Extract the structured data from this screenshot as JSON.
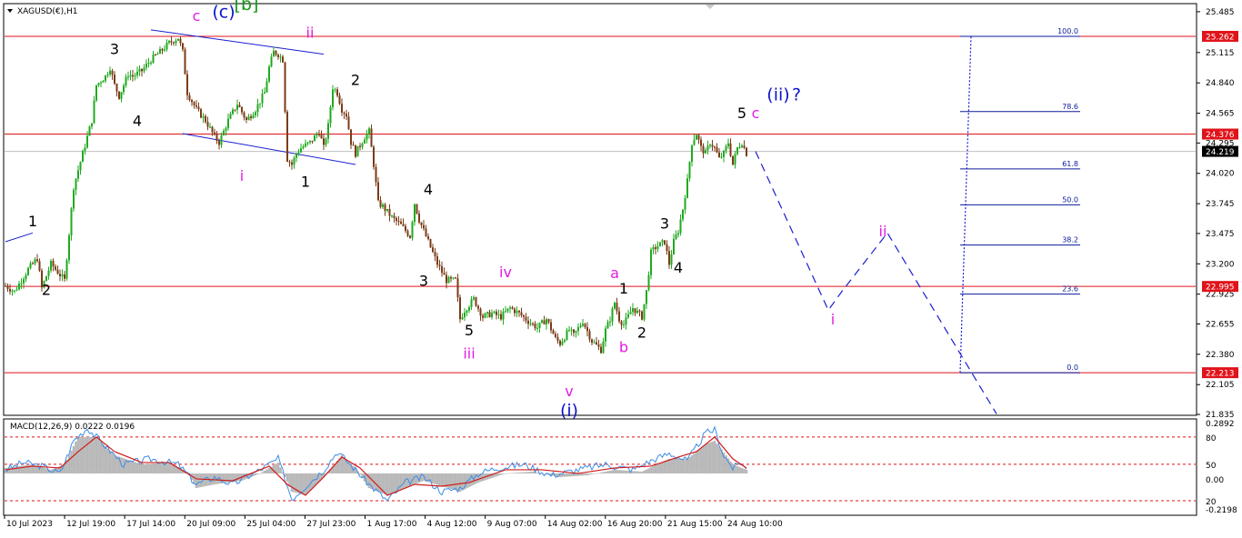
{
  "chart_data": {
    "type": "candlestick",
    "symbol_label": "XAGUSD(€),H1",
    "macd_label": "MACD(12,26,9) 0.0222 0.0196",
    "colors": {
      "up": "#1faa1f",
      "down": "#7a3b16",
      "hline": "#e0131a",
      "price_tag": "#e0131a",
      "current_tag": "#000000",
      "fib": "#0a1a9c",
      "projection": "#1b1fd0",
      "wave_magenta": "#e21ce0",
      "wave_black": "#000000",
      "wave_blue": "#0d15c8",
      "wave_green": "#0f9b0f",
      "macd_hist": "#b8b8b8",
      "macd_main": "#3d8ee6",
      "macd_signal": "#d11a1a",
      "macd_level": "#e0131a"
    },
    "price_axis": {
      "range": [
        21.835,
        25.55
      ],
      "ticks": [
        "25.485",
        "25.115",
        "24.840",
        "24.565",
        "24.295",
        "24.020",
        "23.745",
        "23.475",
        "23.200",
        "22.925",
        "22.655",
        "22.380",
        "22.105",
        "21.835"
      ]
    },
    "price_tags": [
      {
        "label": "25.262",
        "price": 25.262,
        "kind": "level"
      },
      {
        "label": "24.376",
        "price": 24.376,
        "kind": "level"
      },
      {
        "label": "24.219",
        "price": 24.219,
        "kind": "current"
      },
      {
        "label": "22.995",
        "price": 22.995,
        "kind": "level"
      },
      {
        "label": "22.213",
        "price": 22.213,
        "kind": "level"
      }
    ],
    "horizontal_levels": [
      25.262,
      24.376,
      22.995,
      22.213
    ],
    "current_price": 24.219,
    "time_axis": [
      "10 Jul 2023",
      "12 Jul 19:00",
      "17 Jul 14:00",
      "20 Jul 09:00",
      "25 Jul 04:00",
      "27 Jul 23:00",
      "1 Aug 17:00",
      "4 Aug 12:00",
      "9 Aug 07:00",
      "14 Aug 02:00",
      "16 Aug 20:00",
      "21 Aug 15:00",
      "24 Aug 10:00"
    ],
    "fib_levels": [
      {
        "label": "100.0",
        "price": 25.262
      },
      {
        "label": "78.6",
        "price": 24.58
      },
      {
        "label": "61.8",
        "price": 24.06
      },
      {
        "label": "50.0",
        "price": 23.735
      },
      {
        "label": "38.2",
        "price": 23.37
      },
      {
        "label": "23.6",
        "price": 22.925
      },
      {
        "label": "0.0",
        "price": 22.213
      }
    ],
    "price_path": [
      {
        "t": 0,
        "p": 23.0
      },
      {
        "t": 2,
        "p": 22.95
      },
      {
        "t": 5,
        "p": 23.15
      },
      {
        "t": 7,
        "p": 23.25
      },
      {
        "t": 8,
        "p": 22.98
      },
      {
        "t": 10,
        "p": 23.2
      },
      {
        "t": 12,
        "p": 23.1
      },
      {
        "t": 13,
        "p": 23.05
      },
      {
        "t": 15,
        "p": 23.9
      },
      {
        "t": 17,
        "p": 24.2
      },
      {
        "t": 19,
        "p": 24.5
      },
      {
        "t": 20,
        "p": 24.82
      },
      {
        "t": 22,
        "p": 24.9
      },
      {
        "t": 23,
        "p": 24.98
      },
      {
        "t": 24,
        "p": 24.82
      },
      {
        "t": 25,
        "p": 24.72
      },
      {
        "t": 27,
        "p": 24.92
      },
      {
        "t": 28,
        "p": 24.9
      },
      {
        "t": 30,
        "p": 24.95
      },
      {
        "t": 32,
        "p": 25.05
      },
      {
        "t": 34,
        "p": 25.12
      },
      {
        "t": 36,
        "p": 25.2
      },
      {
        "t": 38,
        "p": 25.25
      },
      {
        "t": 39,
        "p": 25.12
      },
      {
        "t": 40,
        "p": 24.75
      },
      {
        "t": 42,
        "p": 24.6
      },
      {
        "t": 44,
        "p": 24.5
      },
      {
        "t": 46,
        "p": 24.35
      },
      {
        "t": 47,
        "p": 24.3
      },
      {
        "t": 49,
        "p": 24.5
      },
      {
        "t": 51,
        "p": 24.65
      },
      {
        "t": 53,
        "p": 24.5
      },
      {
        "t": 55,
        "p": 24.6
      },
      {
        "t": 57,
        "p": 24.75
      },
      {
        "t": 58,
        "p": 24.98
      },
      {
        "t": 59,
        "p": 25.12
      },
      {
        "t": 60,
        "p": 25.1
      },
      {
        "t": 61,
        "p": 25.05
      },
      {
        "t": 62,
        "p": 24.15
      },
      {
        "t": 63,
        "p": 24.1
      },
      {
        "t": 64,
        "p": 24.2
      },
      {
        "t": 65,
        "p": 24.25
      },
      {
        "t": 67,
        "p": 24.3
      },
      {
        "t": 69,
        "p": 24.4
      },
      {
        "t": 70,
        "p": 24.25
      },
      {
        "t": 71,
        "p": 24.45
      },
      {
        "t": 72,
        "p": 24.8
      },
      {
        "t": 73,
        "p": 24.75
      },
      {
        "t": 74,
        "p": 24.6
      },
      {
        "t": 75,
        "p": 24.55
      },
      {
        "t": 76,
        "p": 24.3
      },
      {
        "t": 77,
        "p": 24.2
      },
      {
        "t": 79,
        "p": 24.35
      },
      {
        "t": 80,
        "p": 24.4
      },
      {
        "t": 81,
        "p": 24.1
      },
      {
        "t": 82,
        "p": 23.75
      },
      {
        "t": 83,
        "p": 23.72
      },
      {
        "t": 85,
        "p": 23.62
      },
      {
        "t": 87,
        "p": 23.55
      },
      {
        "t": 89,
        "p": 23.45
      },
      {
        "t": 90,
        "p": 23.75
      },
      {
        "t": 91,
        "p": 23.6
      },
      {
        "t": 93,
        "p": 23.4
      },
      {
        "t": 95,
        "p": 23.2
      },
      {
        "t": 97,
        "p": 23.05
      },
      {
        "t": 99,
        "p": 23.05
      },
      {
        "t": 100,
        "p": 22.7
      },
      {
        "t": 101,
        "p": 22.78
      },
      {
        "t": 103,
        "p": 22.88
      },
      {
        "t": 105,
        "p": 22.72
      },
      {
        "t": 107,
        "p": 22.75
      },
      {
        "t": 109,
        "p": 22.72
      },
      {
        "t": 111,
        "p": 22.8
      },
      {
        "t": 113,
        "p": 22.75
      },
      {
        "t": 115,
        "p": 22.68
      },
      {
        "t": 117,
        "p": 22.62
      },
      {
        "t": 119,
        "p": 22.7
      },
      {
        "t": 121,
        "p": 22.52
      },
      {
        "t": 122,
        "p": 22.48
      },
      {
        "t": 124,
        "p": 22.6
      },
      {
        "t": 125,
        "p": 22.55
      },
      {
        "t": 127,
        "p": 22.68
      },
      {
        "t": 129,
        "p": 22.5
      },
      {
        "t": 131,
        "p": 22.42
      },
      {
        "t": 132,
        "p": 22.6
      },
      {
        "t": 133,
        "p": 22.7
      },
      {
        "t": 134,
        "p": 22.85
      },
      {
        "t": 135,
        "p": 22.7
      },
      {
        "t": 136,
        "p": 22.65
      },
      {
        "t": 138,
        "p": 22.8
      },
      {
        "t": 140,
        "p": 22.72
      },
      {
        "t": 141,
        "p": 22.95
      },
      {
        "t": 142,
        "p": 23.3
      },
      {
        "t": 143,
        "p": 23.35
      },
      {
        "t": 145,
        "p": 23.4
      },
      {
        "t": 146,
        "p": 23.2
      },
      {
        "t": 147,
        "p": 23.4
      },
      {
        "t": 148,
        "p": 23.5
      },
      {
        "t": 149,
        "p": 23.7
      },
      {
        "t": 150,
        "p": 23.95
      },
      {
        "t": 151,
        "p": 24.3
      },
      {
        "t": 152,
        "p": 24.38
      },
      {
        "t": 153,
        "p": 24.25
      },
      {
        "t": 154,
        "p": 24.2
      },
      {
        "t": 155,
        "p": 24.3
      },
      {
        "t": 156,
        "p": 24.25
      },
      {
        "t": 157,
        "p": 24.15
      },
      {
        "t": 158,
        "p": 24.2
      },
      {
        "t": 159,
        "p": 24.3
      },
      {
        "t": 160,
        "p": 24.1
      },
      {
        "t": 161,
        "p": 24.25
      },
      {
        "t": 162,
        "p": 24.3
      },
      {
        "t": 163,
        "p": 24.2
      }
    ],
    "projection_path": [
      {
        "t": 165,
        "p": 24.219
      },
      {
        "t": 181,
        "p": 22.78
      },
      {
        "t": 184,
        "p": 22.95
      },
      {
        "t": 194,
        "p": 23.48
      },
      {
        "t": 218,
        "p": 21.84
      }
    ],
    "fib_vertical_t": 210,
    "wave_labels": [
      {
        "text": "1",
        "t": 6,
        "p": 23.54,
        "color": "wave_black"
      },
      {
        "text": "2",
        "t": 9,
        "p": 22.92,
        "color": "wave_black"
      },
      {
        "text": "3",
        "t": 24,
        "p": 25.1,
        "color": "wave_black"
      },
      {
        "text": "4",
        "t": 29,
        "p": 24.45,
        "color": "wave_black"
      },
      {
        "text": "c",
        "t": 42,
        "p": 25.4,
        "color": "wave_magenta"
      },
      {
        "text": "(c)",
        "t": 48,
        "p": 25.43,
        "color": "wave_blue"
      },
      {
        "text": "[b]",
        "t": 53,
        "p": 25.5,
        "color": "wave_green"
      },
      {
        "text": "ii",
        "t": 67,
        "p": 25.25,
        "color": "wave_magenta"
      },
      {
        "text": "i",
        "t": 52,
        "p": 23.95,
        "color": "wave_magenta"
      },
      {
        "text": "1",
        "t": 66,
        "p": 23.9,
        "color": "wave_black"
      },
      {
        "text": "2",
        "t": 77,
        "p": 24.82,
        "color": "wave_black"
      },
      {
        "text": "4",
        "t": 93,
        "p": 23.83,
        "color": "wave_black"
      },
      {
        "text": "3",
        "t": 92,
        "p": 23.0,
        "color": "wave_black"
      },
      {
        "text": "5",
        "t": 102,
        "p": 22.55,
        "color": "wave_black"
      },
      {
        "text": "iii",
        "t": 102,
        "p": 22.34,
        "color": "wave_magenta"
      },
      {
        "text": "iv",
        "t": 110,
        "p": 23.08,
        "color": "wave_magenta"
      },
      {
        "text": "v",
        "t": 124,
        "p": 22.0,
        "color": "wave_magenta"
      },
      {
        "text": "(i)",
        "t": 124,
        "p": 21.82,
        "color": "wave_blue"
      },
      {
        "text": "a",
        "t": 134,
        "p": 23.07,
        "color": "wave_magenta"
      },
      {
        "text": "1",
        "t": 136,
        "p": 22.93,
        "color": "wave_black"
      },
      {
        "text": "b",
        "t": 136,
        "p": 22.4,
        "color": "wave_magenta"
      },
      {
        "text": "2",
        "t": 140,
        "p": 22.53,
        "color": "wave_black"
      },
      {
        "text": "3",
        "t": 145,
        "p": 23.52,
        "color": "wave_black"
      },
      {
        "text": "4",
        "t": 148,
        "p": 23.12,
        "color": "wave_black"
      },
      {
        "text": "5",
        "t": 162,
        "p": 24.52,
        "color": "wave_black"
      },
      {
        "text": "c",
        "t": 165,
        "p": 24.52,
        "color": "wave_magenta"
      },
      {
        "text": "(ii)",
        "t": 170,
        "p": 24.68,
        "color": "wave_blue"
      },
      {
        "text": "?",
        "t": 174,
        "p": 24.68,
        "color": "wave_blue"
      },
      {
        "text": "i",
        "t": 182,
        "p": 22.65,
        "color": "wave_magenta"
      },
      {
        "text": "ii",
        "t": 193,
        "p": 23.45,
        "color": "wave_magenta"
      }
    ],
    "trendlines": [
      {
        "t1": 32,
        "p1": 25.32,
        "t2": 70,
        "p2": 25.1
      },
      {
        "t1": 39,
        "p1": 24.38,
        "t2": 77,
        "p2": 24.1
      },
      {
        "t1": 0,
        "p1": 23.4,
        "t2": 6,
        "p2": 23.48
      }
    ],
    "macd": {
      "axis_labels": [
        "0.2892",
        "80",
        "50",
        "0.00",
        "20",
        "-0.2198"
      ],
      "range": [
        -0.2198,
        0.2892
      ],
      "levels": [
        0.2,
        0.05,
        -0.15
      ],
      "histogram": [
        {
          "t": 0,
          "v": 0.03
        },
        {
          "t": 6,
          "v": 0.05
        },
        {
          "t": 10,
          "v": 0.02
        },
        {
          "t": 13,
          "v": 0.05
        },
        {
          "t": 16,
          "v": 0.2
        },
        {
          "t": 20,
          "v": 0.2
        },
        {
          "t": 24,
          "v": 0.1
        },
        {
          "t": 30,
          "v": 0.05
        },
        {
          "t": 36,
          "v": 0.06
        },
        {
          "t": 40,
          "v": 0.01
        },
        {
          "t": 42,
          "v": -0.08
        },
        {
          "t": 46,
          "v": -0.06
        },
        {
          "t": 52,
          "v": -0.04
        },
        {
          "t": 56,
          "v": 0.0
        },
        {
          "t": 60,
          "v": 0.06
        },
        {
          "t": 63,
          "v": -0.1
        },
        {
          "t": 66,
          "v": -0.12
        },
        {
          "t": 70,
          "v": -0.02
        },
        {
          "t": 74,
          "v": 0.1
        },
        {
          "t": 77,
          "v": 0.03
        },
        {
          "t": 80,
          "v": -0.08
        },
        {
          "t": 84,
          "v": -0.12
        },
        {
          "t": 88,
          "v": -0.08
        },
        {
          "t": 92,
          "v": -0.04
        },
        {
          "t": 96,
          "v": -0.07
        },
        {
          "t": 100,
          "v": -0.1
        },
        {
          "t": 104,
          "v": -0.05
        },
        {
          "t": 110,
          "v": 0.0
        },
        {
          "t": 116,
          "v": 0.01
        },
        {
          "t": 122,
          "v": -0.02
        },
        {
          "t": 128,
          "v": -0.01
        },
        {
          "t": 134,
          "v": 0.02
        },
        {
          "t": 140,
          "v": 0.01
        },
        {
          "t": 146,
          "v": 0.08
        },
        {
          "t": 150,
          "v": 0.08
        },
        {
          "t": 154,
          "v": 0.16
        },
        {
          "t": 156,
          "v": 0.18
        },
        {
          "t": 160,
          "v": 0.05
        },
        {
          "t": 163,
          "v": 0.02
        }
      ],
      "main_line": [
        {
          "t": 0,
          "v": 0.02
        },
        {
          "t": 4,
          "v": 0.06
        },
        {
          "t": 8,
          "v": 0.04
        },
        {
          "t": 12,
          "v": 0.0
        },
        {
          "t": 15,
          "v": 0.18
        },
        {
          "t": 18,
          "v": 0.25
        },
        {
          "t": 22,
          "v": 0.15
        },
        {
          "t": 26,
          "v": 0.05
        },
        {
          "t": 32,
          "v": 0.08
        },
        {
          "t": 38,
          "v": 0.05
        },
        {
          "t": 42,
          "v": -0.06
        },
        {
          "t": 46,
          "v": -0.02
        },
        {
          "t": 50,
          "v": -0.06
        },
        {
          "t": 56,
          "v": 0.02
        },
        {
          "t": 60,
          "v": 0.08
        },
        {
          "t": 63,
          "v": -0.14
        },
        {
          "t": 66,
          "v": -0.07
        },
        {
          "t": 70,
          "v": 0.02
        },
        {
          "t": 73,
          "v": 0.12
        },
        {
          "t": 77,
          "v": 0.02
        },
        {
          "t": 80,
          "v": -0.06
        },
        {
          "t": 84,
          "v": -0.15
        },
        {
          "t": 88,
          "v": -0.05
        },
        {
          "t": 92,
          "v": -0.02
        },
        {
          "t": 96,
          "v": -0.1
        },
        {
          "t": 100,
          "v": -0.08
        },
        {
          "t": 104,
          "v": 0.0
        },
        {
          "t": 108,
          "v": 0.03
        },
        {
          "t": 114,
          "v": 0.05
        },
        {
          "t": 120,
          "v": -0.01
        },
        {
          "t": 126,
          "v": 0.02
        },
        {
          "t": 132,
          "v": 0.05
        },
        {
          "t": 138,
          "v": 0.02
        },
        {
          "t": 142,
          "v": 0.07
        },
        {
          "t": 146,
          "v": 0.11
        },
        {
          "t": 150,
          "v": 0.07
        },
        {
          "t": 154,
          "v": 0.22
        },
        {
          "t": 156,
          "v": 0.24
        },
        {
          "t": 158,
          "v": 0.1
        },
        {
          "t": 160,
          "v": 0.03
        },
        {
          "t": 162,
          "v": 0.06
        },
        {
          "t": 163,
          "v": 0.02
        }
      ],
      "signal_line": [
        {
          "t": 0,
          "v": 0.02
        },
        {
          "t": 6,
          "v": 0.04
        },
        {
          "t": 12,
          "v": 0.03
        },
        {
          "t": 16,
          "v": 0.12
        },
        {
          "t": 20,
          "v": 0.2
        },
        {
          "t": 24,
          "v": 0.12
        },
        {
          "t": 30,
          "v": 0.06
        },
        {
          "t": 36,
          "v": 0.06
        },
        {
          "t": 42,
          "v": -0.03
        },
        {
          "t": 50,
          "v": -0.04
        },
        {
          "t": 58,
          "v": 0.04
        },
        {
          "t": 62,
          "v": -0.06
        },
        {
          "t": 66,
          "v": -0.12
        },
        {
          "t": 70,
          "v": -0.02
        },
        {
          "t": 74,
          "v": 0.09
        },
        {
          "t": 78,
          "v": 0.03
        },
        {
          "t": 84,
          "v": -0.12
        },
        {
          "t": 90,
          "v": -0.06
        },
        {
          "t": 96,
          "v": -0.07
        },
        {
          "t": 102,
          "v": -0.05
        },
        {
          "t": 110,
          "v": 0.02
        },
        {
          "t": 118,
          "v": 0.02
        },
        {
          "t": 126,
          "v": 0.0
        },
        {
          "t": 134,
          "v": 0.03
        },
        {
          "t": 142,
          "v": 0.04
        },
        {
          "t": 148,
          "v": 0.09
        },
        {
          "t": 152,
          "v": 0.12
        },
        {
          "t": 156,
          "v": 0.2
        },
        {
          "t": 160,
          "v": 0.08
        },
        {
          "t": 163,
          "v": 0.03
        }
      ]
    }
  }
}
